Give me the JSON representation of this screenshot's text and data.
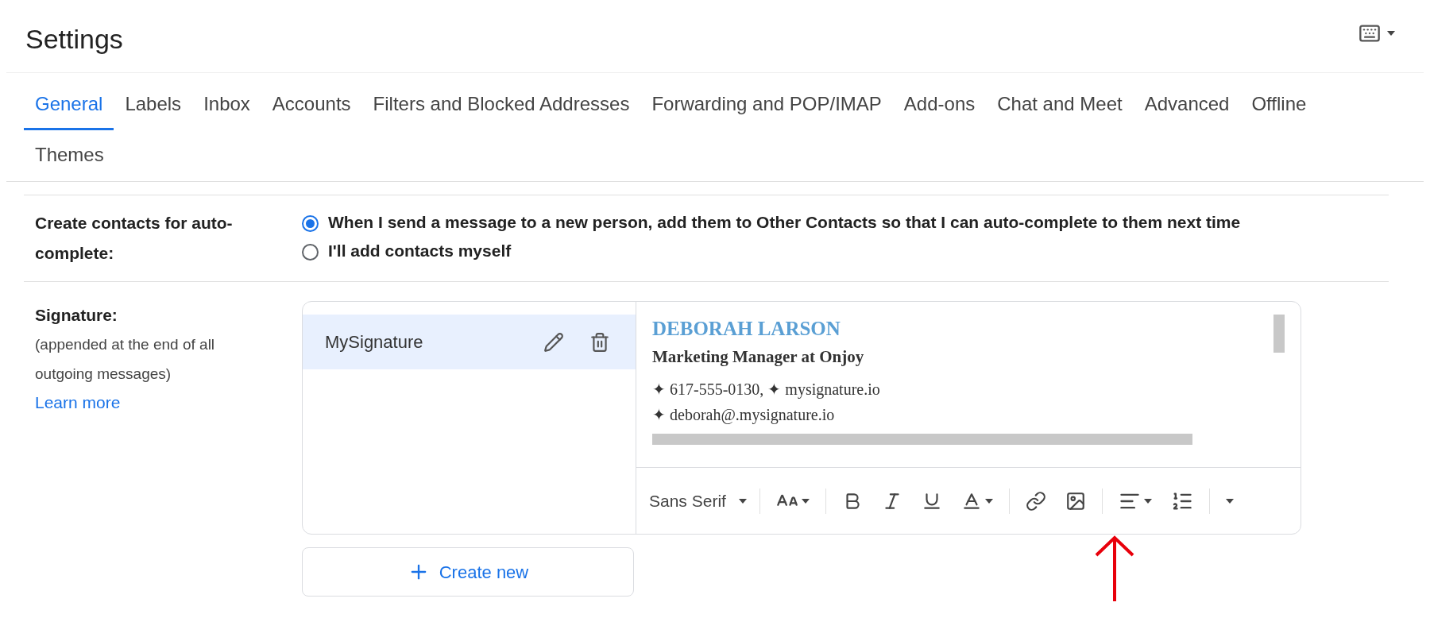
{
  "header": {
    "title": "Settings"
  },
  "tabs": [
    {
      "label": "General",
      "selected": true
    },
    {
      "label": "Labels",
      "selected": false
    },
    {
      "label": "Inbox",
      "selected": false
    },
    {
      "label": "Accounts",
      "selected": false
    },
    {
      "label": "Filters and Blocked Addresses",
      "selected": false
    },
    {
      "label": "Forwarding and POP/IMAP",
      "selected": false
    },
    {
      "label": "Add-ons",
      "selected": false
    },
    {
      "label": "Chat and Meet",
      "selected": false
    },
    {
      "label": "Advanced",
      "selected": false
    },
    {
      "label": "Offline",
      "selected": false
    },
    {
      "label": "Themes",
      "selected": false
    }
  ],
  "settings": [
    {
      "kind": "radio",
      "label": "Create contacts for auto-complete:",
      "options": [
        {
          "label": "When I send a message to a new person, add them to Other Contacts so that I can auto-complete to them next time",
          "selected": true
        },
        {
          "label": "I'll add contacts myself",
          "selected": false
        }
      ]
    },
    {
      "kind": "signature",
      "label": "Signature:",
      "description": "(appended at the end of all outgoing messages)",
      "link": "Learn more",
      "signatures": [
        {
          "name": "MySignature",
          "selected": true
        }
      ],
      "preview": {
        "name": "DEBORAH LARSON",
        "title": "Marketing Manager at Onjoy",
        "lines": [
          "✦ 617-555-0130, ✦ mysignature.io",
          "✦ deborah@.mysignature.io"
        ]
      },
      "toolbar": {
        "font": "Sans Serif"
      },
      "create_button": "Create new"
    }
  ]
}
